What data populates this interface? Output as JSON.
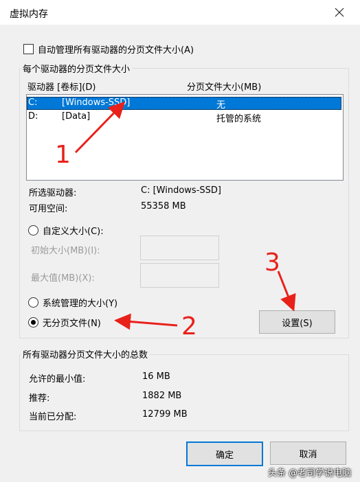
{
  "window": {
    "title": "虚拟内存"
  },
  "auto_manage": {
    "label": "自动管理所有驱动器的分页文件大小(A)",
    "checked": false
  },
  "per_drive_group": {
    "legend": "每个驱动器的分页文件大小"
  },
  "drive_list": {
    "headers": {
      "drive": "驱动器 [卷标](D)",
      "size": "分页文件大小(MB)"
    },
    "rows": [
      {
        "letter": "C:",
        "label": "[Windows-SSD]",
        "size": "无",
        "selected": true
      },
      {
        "letter": "D:",
        "label": "[Data]",
        "size": "托管的系统",
        "selected": false
      }
    ]
  },
  "selected_info": {
    "drive_label": "所选驱动器:",
    "drive_value": "C:  [Windows-SSD]",
    "space_label": "可用空间:",
    "space_value": "55358 MB"
  },
  "options": {
    "custom_size": "自定义大小(C):",
    "initial_size_label": "初始大小(MB)(I):",
    "max_size_label": "最大值(MB)(X):",
    "system_managed": "系统管理的大小(Y)",
    "no_paging": "无分页文件(N)",
    "selected": "no_paging"
  },
  "set_button": "设置(S)",
  "totals_group": {
    "legend": "所有驱动器分页文件大小的总数",
    "min_label": "允许的最小值:",
    "min_value": "16 MB",
    "recommended_label": "推荐:",
    "recommended_value": "1882 MB",
    "current_label": "当前已分配:",
    "current_value": "12799 MB"
  },
  "buttons": {
    "ok": "确定",
    "cancel": "取消"
  },
  "annotations": {
    "arrow1": "1",
    "arrow2": "2",
    "arrow3": "3",
    "arrow_color": "#e8211a"
  },
  "watermark": "头条 @老司学说电脑"
}
